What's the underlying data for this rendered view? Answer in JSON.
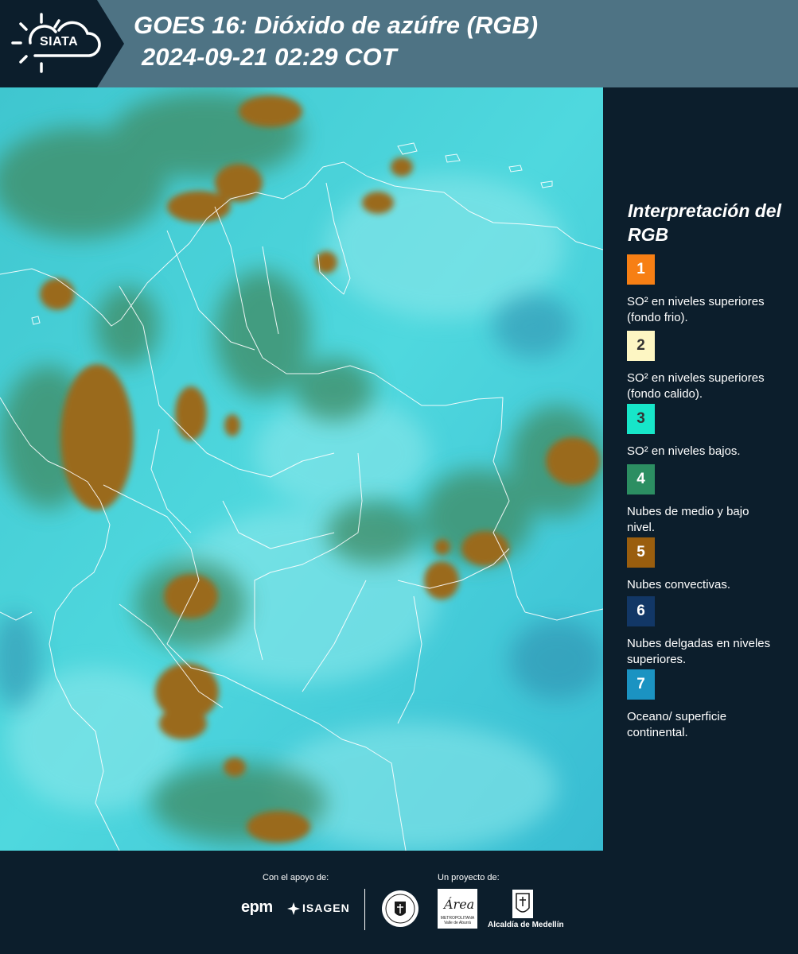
{
  "header": {
    "logo_text": "SIATA",
    "title_line1": "GOES 16: Dióxido de azúfre (RGB)",
    "title_line2": "2024-09-21 02:29 COT"
  },
  "legend": {
    "title": "Interpretación del RGB",
    "items": [
      {
        "number": "1",
        "color": "#f77f14",
        "text": "SO² en niveles superiores (fondo frio)."
      },
      {
        "number": "2",
        "color": "#fdf6c3",
        "text": "SO² en niveles superiores (fondo calido)."
      },
      {
        "number": "3",
        "color": "#17e6c9",
        "text": "SO² en niveles bajos."
      },
      {
        "number": "4",
        "color": "#2c8e62",
        "text": "Nubes de medio y bajo nivel."
      },
      {
        "number": "5",
        "color": "#9a5e0e",
        "text": "Nubes convectivas."
      },
      {
        "number": "6",
        "color": "#123766",
        "text": "Nubes delgadas en niveles superiores."
      },
      {
        "number": "7",
        "color": "#1b93c2",
        "text": "Oceano/ superficie continental."
      }
    ]
  },
  "footer": {
    "support_label": "Con el apoyo de:",
    "project_label": "Un proyecto de:",
    "epm": "epm",
    "isagen": "ISAGEN",
    "area_word": "Área",
    "area_sub": "METROPOLITANA Valle de Aburrá",
    "alcaldia": "Alcaldía de Medellín"
  },
  "colors": {
    "background": "#0c1e2c",
    "header": "#4e7384",
    "map_base": "#45d3d9"
  }
}
